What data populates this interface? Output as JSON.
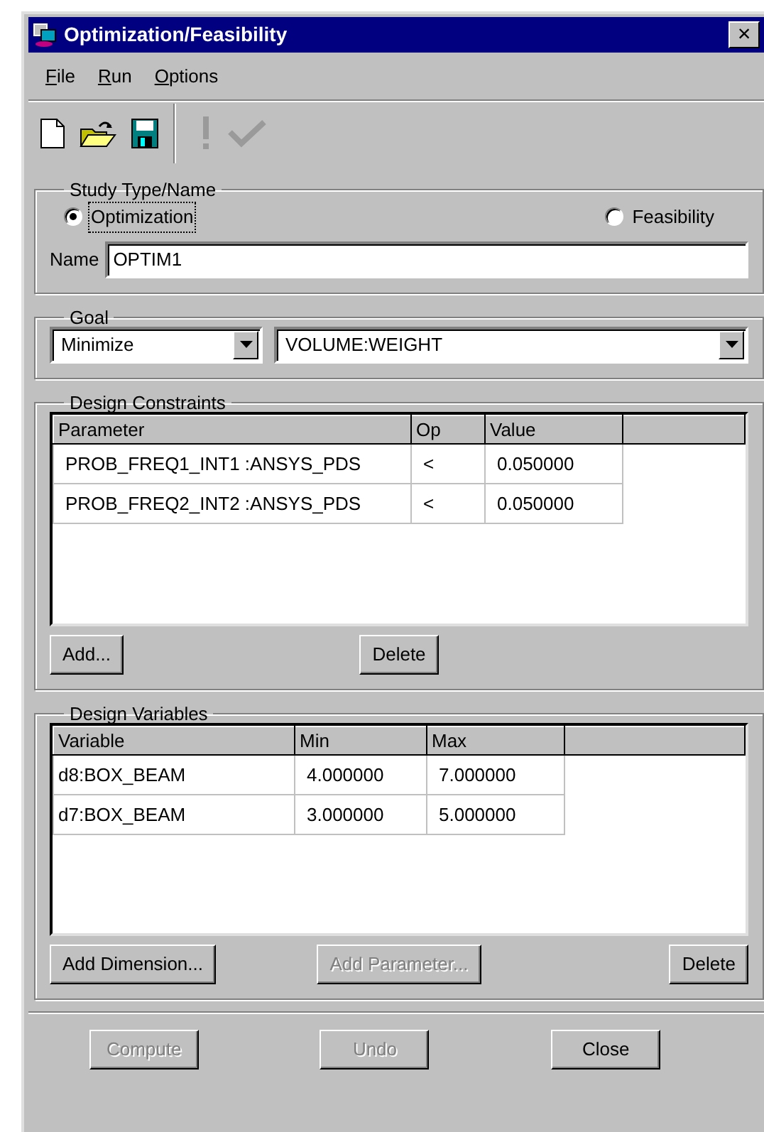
{
  "window": {
    "title": "Optimization/Feasibility",
    "close_glyph": "×"
  },
  "menu": [
    {
      "label": "File"
    },
    {
      "label": "Run"
    },
    {
      "label": "Options"
    }
  ],
  "toolbar_groups": [
    [
      {
        "kind": "new",
        "disabled": false
      },
      {
        "kind": "open",
        "disabled": false
      },
      {
        "kind": "save",
        "disabled": false
      }
    ],
    [
      {
        "kind": "run",
        "disabled": true
      },
      {
        "kind": "verify",
        "disabled": true
      }
    ]
  ],
  "study": {
    "title": "Study Type/Name",
    "options": [
      {
        "label": "Optimization",
        "selected": true,
        "focused": true
      },
      {
        "label": "Feasibility",
        "selected": false,
        "focused": false
      }
    ],
    "name_label": "Name",
    "name_value": "OPTIM1"
  },
  "goal": {
    "title": "Goal",
    "type": "Minimize",
    "target": "VOLUME:WEIGHT"
  },
  "constraints": {
    "title": "Design Constraints",
    "columns": [
      "Parameter",
      "Op",
      "Value"
    ],
    "rows": [
      [
        "PROB_FREQ1_INT1 :ANSYS_PDS",
        "<",
        "0.050000"
      ],
      [
        "PROB_FREQ2_INT2 :ANSYS_PDS",
        "<",
        "0.050000"
      ]
    ],
    "buttons": [
      {
        "label": "Add...",
        "disabled": false
      },
      {
        "label": "Delete",
        "disabled": false
      }
    ]
  },
  "variables": {
    "title": "Design Variables",
    "columns": [
      "Variable",
      "Min",
      "Max"
    ],
    "rows": [
      [
        "d8:BOX_BEAM",
        "4.000000",
        "7.000000"
      ],
      [
        "d7:BOX_BEAM",
        "3.000000",
        "5.000000"
      ]
    ],
    "buttons": [
      {
        "label": "Add Dimension...",
        "disabled": false
      },
      {
        "label": "Add Parameter...",
        "disabled": true
      },
      {
        "label": "Delete",
        "disabled": false
      }
    ]
  },
  "footer_buttons": [
    {
      "label": "Compute",
      "disabled": true
    },
    {
      "label": "Undo",
      "disabled": true
    },
    {
      "label": "Close",
      "disabled": false
    }
  ]
}
